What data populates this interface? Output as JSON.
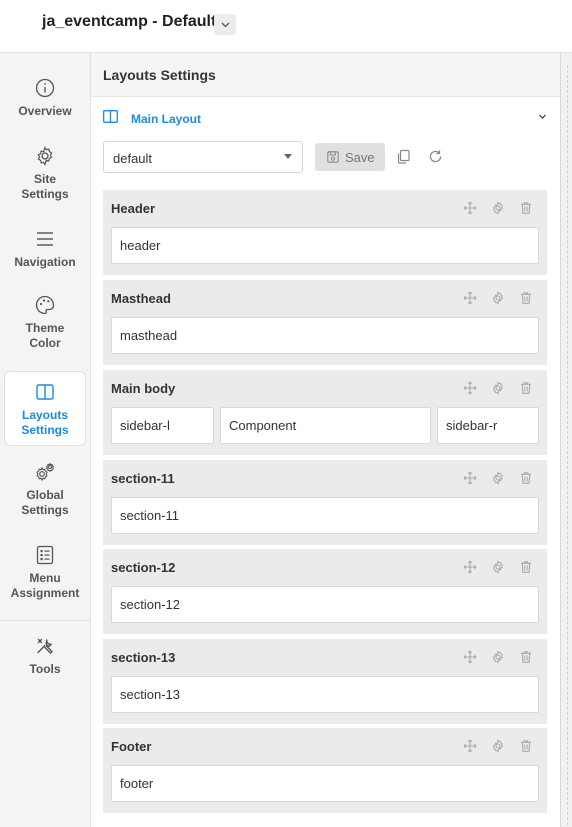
{
  "header": {
    "template_title": "ja_eventcamp - Default"
  },
  "sidebar": {
    "items": [
      {
        "label": "Overview",
        "icon": "info-circle-icon"
      },
      {
        "label": "Site\nSettings",
        "icon": "gear-icon"
      },
      {
        "label": "Navigation",
        "icon": "menu-lines-icon"
      },
      {
        "label": "Theme\nColor",
        "icon": "palette-icon"
      },
      {
        "label": "Layouts\nSettings",
        "icon": "columns-icon",
        "active": true
      },
      {
        "label": "Global\nSettings",
        "icon": "gears-icon"
      },
      {
        "label": "Menu\nAssignment",
        "icon": "list-icon"
      },
      {
        "label": "Tools",
        "icon": "tools-icon"
      }
    ]
  },
  "main": {
    "title": "Layouts Settings",
    "main_layout_label": "Main Layout",
    "layout_select_value": "default",
    "save_label": "Save",
    "sections": [
      {
        "title": "Header",
        "positions": [
          "header"
        ]
      },
      {
        "title": "Masthead",
        "positions": [
          "masthead"
        ]
      },
      {
        "title": "Main body",
        "positions": [
          "sidebar-l",
          "Component",
          "sidebar-r"
        ]
      },
      {
        "title": "section-11",
        "positions": [
          "section-11"
        ]
      },
      {
        "title": "section-12",
        "positions": [
          "section-12"
        ]
      },
      {
        "title": "section-13",
        "positions": [
          "section-13"
        ]
      },
      {
        "title": "Footer",
        "positions": [
          "footer"
        ]
      }
    ]
  },
  "colors": {
    "accent": "#1e88e5",
    "sidebar_bg": "#f4f4f4",
    "section_bg": "#ebebeb"
  }
}
